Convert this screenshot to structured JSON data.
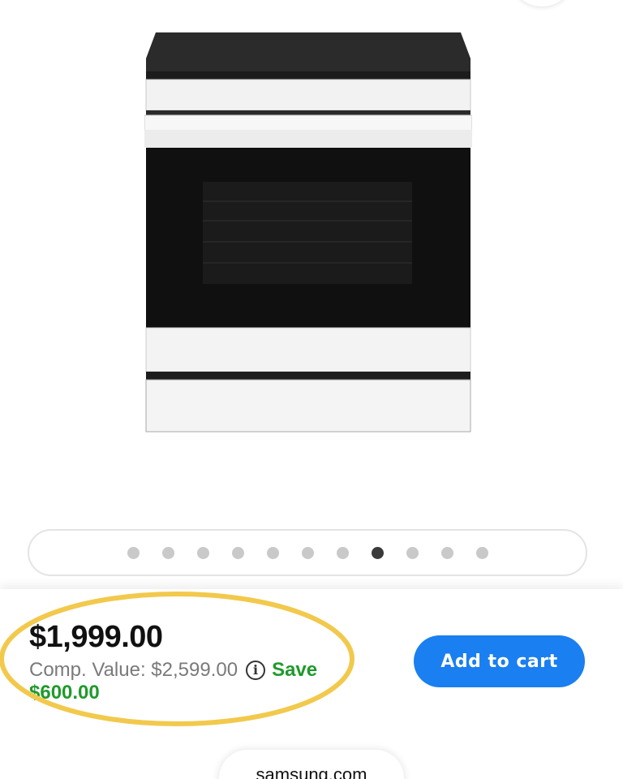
{
  "product": {
    "image_icon": "slide-in-range-product-photo",
    "price": "$1,999.00",
    "comp_value_label": "Comp. Value: $2,599.00",
    "info_icon_glyph": "i",
    "save_label": "Save",
    "save_amount": "$600.00"
  },
  "carousel": {
    "total_slides": 11,
    "active_index": 7
  },
  "actions": {
    "add_to_cart_label": "Add to cart"
  },
  "browser": {
    "url_text": "samsung.com"
  },
  "colors": {
    "accent_blue": "#1a7ff0",
    "save_green": "#1f9a2b",
    "highlight_yellow": "#f2c94c"
  }
}
